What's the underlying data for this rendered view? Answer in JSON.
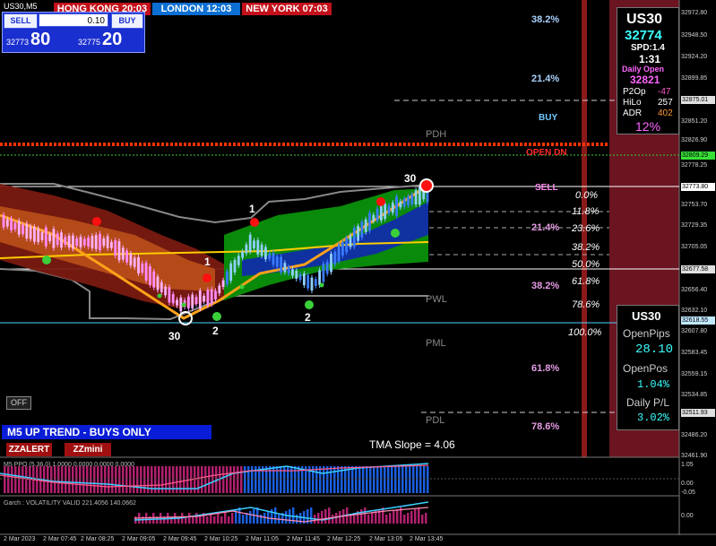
{
  "window_title": "US30,M5",
  "clocks": [
    {
      "label": "HONG KONG 20:03",
      "color": "#c3101a"
    },
    {
      "label": "LONDON  12:03",
      "color": "#0b6fd3"
    },
    {
      "label": "NEW YORK 07:03",
      "color": "#c3101a"
    }
  ],
  "trade_panel": {
    "sell_label": "SELL",
    "buy_label": "BUY",
    "lot_size": "0.10",
    "bid_small": "32773",
    "bid_big": "80",
    "ask_small": "32775",
    "ask_big": "20"
  },
  "fib_levels_left": [
    {
      "text": "38.2%",
      "color": "#a9d3ff"
    },
    {
      "text": "21.4%",
      "color": "#a9d3ff"
    },
    {
      "text": "BUY",
      "color": "#6fc8ff"
    },
    {
      "text": "OPEN  DN",
      "color": "#ff2a2a"
    },
    {
      "text": "SELL",
      "color": "#ff8af0"
    },
    {
      "text": "21.4%",
      "color": "#e69ce6"
    },
    {
      "text": "38.2%",
      "color": "#e69ce6"
    },
    {
      "text": "61.8%",
      "color": "#e69ce6"
    },
    {
      "text": "78.6%",
      "color": "#e69ce6"
    }
  ],
  "fib_levels_right": [
    "0.0%",
    "11.8%",
    "23.6%",
    "38.2%",
    "50.0%",
    "61.8%",
    "78.6%",
    "100.0%"
  ],
  "pivot_labels": [
    "PDH",
    "PWL",
    "PML",
    "PDL"
  ],
  "zigzag_labels": [
    "30",
    "1",
    "1",
    "30",
    "2",
    "2"
  ],
  "info_panel": {
    "symbol": "US30",
    "price": "32774",
    "spread": "SPD:1.4",
    "timer": "1:31",
    "daily_open_label": "Daily Open",
    "daily_open": "32821",
    "p2op_label": "P2Op",
    "p2op": "-47",
    "hilo_label": "HiLo",
    "hilo": "257",
    "adr_label": "ADR",
    "adr": "402",
    "adr_pct": "12%"
  },
  "pips_panel": {
    "symbol": "US30",
    "open_pips_label": "OpenPips",
    "open_pips": "28.10",
    "open_pos_label": "OpenPos",
    "open_pos": "1.04%",
    "daily_pl_label": "Daily P/L",
    "daily_pl": "3.02%"
  },
  "trend_banner": "M5 UP TREND - BUYS ONLY",
  "buttons": {
    "off": "OFF",
    "zzalert": "ZZALERT",
    "zzmini": "ZZmini"
  },
  "tma_slope": "TMA Slope = 4.06",
  "indicator1_title": "M5 PPO (5.36.0) 1.0000 0.0000 0.0000 0.0000",
  "indicator2_title": "Garch : VOLATILITY VALID 221.4056 140.0662",
  "price_axis": [
    "32972.80",
    "32948.50",
    "32924.20",
    "32899.85",
    "32875.01",
    "32851.20",
    "32826.90",
    "32809.29",
    "32778.25",
    "32773.80",
    "32753.70",
    "32729.35",
    "32705.05",
    "32677.58",
    "32656.40",
    "32632.10",
    "32618.55",
    "32607.80",
    "32583.45",
    "32559.15",
    "32534.85",
    "32511.93",
    "32486.20",
    "32461.90",
    "1.05",
    "0.00",
    "-0.05",
    "0.00"
  ],
  "time_axis": [
    "2 Mar 2023",
    "2 Mar 07:45",
    "2 Mar 08:25",
    "2 Mar 09:05",
    "2 Mar 09:45",
    "2 Mar 10:25",
    "2 Mar 11:05",
    "2 Mar 11:45",
    "2 Mar 12:25",
    "2 Mar 13:05",
    "2 Mar 13:45"
  ],
  "colors": {
    "up_band": "#0a8a0a",
    "down_band": "#7a1a10",
    "tma": "#ffcc00",
    "zigzag": "#ffa21a",
    "daily_open_line": "#ff3300",
    "current_price_line": "#ffffff"
  }
}
